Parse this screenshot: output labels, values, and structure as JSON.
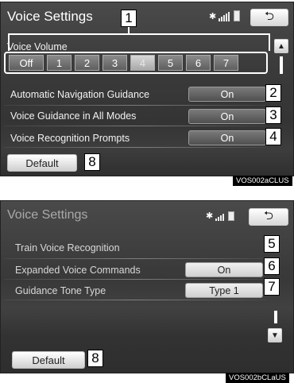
{
  "screen1": {
    "title": "Voice Settings",
    "back_label": "⮌",
    "volume": {
      "label": "Voice Volume",
      "levels": [
        "Off",
        "1",
        "2",
        "3",
        "4",
        "5",
        "6",
        "7"
      ],
      "selected": "4"
    },
    "rows": [
      {
        "label": "Automatic Navigation Guidance",
        "value": "On",
        "callout": "2"
      },
      {
        "label": "Voice Guidance in All Modes",
        "value": "On",
        "callout": "3"
      },
      {
        "label": "Voice Recognition Prompts",
        "value": "On",
        "callout": "4"
      }
    ],
    "default_label": "Default",
    "callout_volume": "1",
    "callout_default": "8",
    "scroll_up": "▲",
    "code": "VOS002aCLUS"
  },
  "screen2": {
    "title": "Voice Settings",
    "back_label": "⮌",
    "rows": [
      {
        "label": "Train Voice Recognition",
        "callout": "5"
      },
      {
        "label": "Expanded Voice Commands",
        "value": "On",
        "callout": "6"
      },
      {
        "label": "Guidance Tone Type",
        "value": "Type 1",
        "callout": "7"
      }
    ],
    "default_label": "Default",
    "callout_default": "8",
    "scroll_down": "▼",
    "code": "VOS002bCLaUS"
  },
  "icons": {
    "bluetooth": "✱",
    "signal": "signal-icon",
    "battery": "battery-icon"
  }
}
